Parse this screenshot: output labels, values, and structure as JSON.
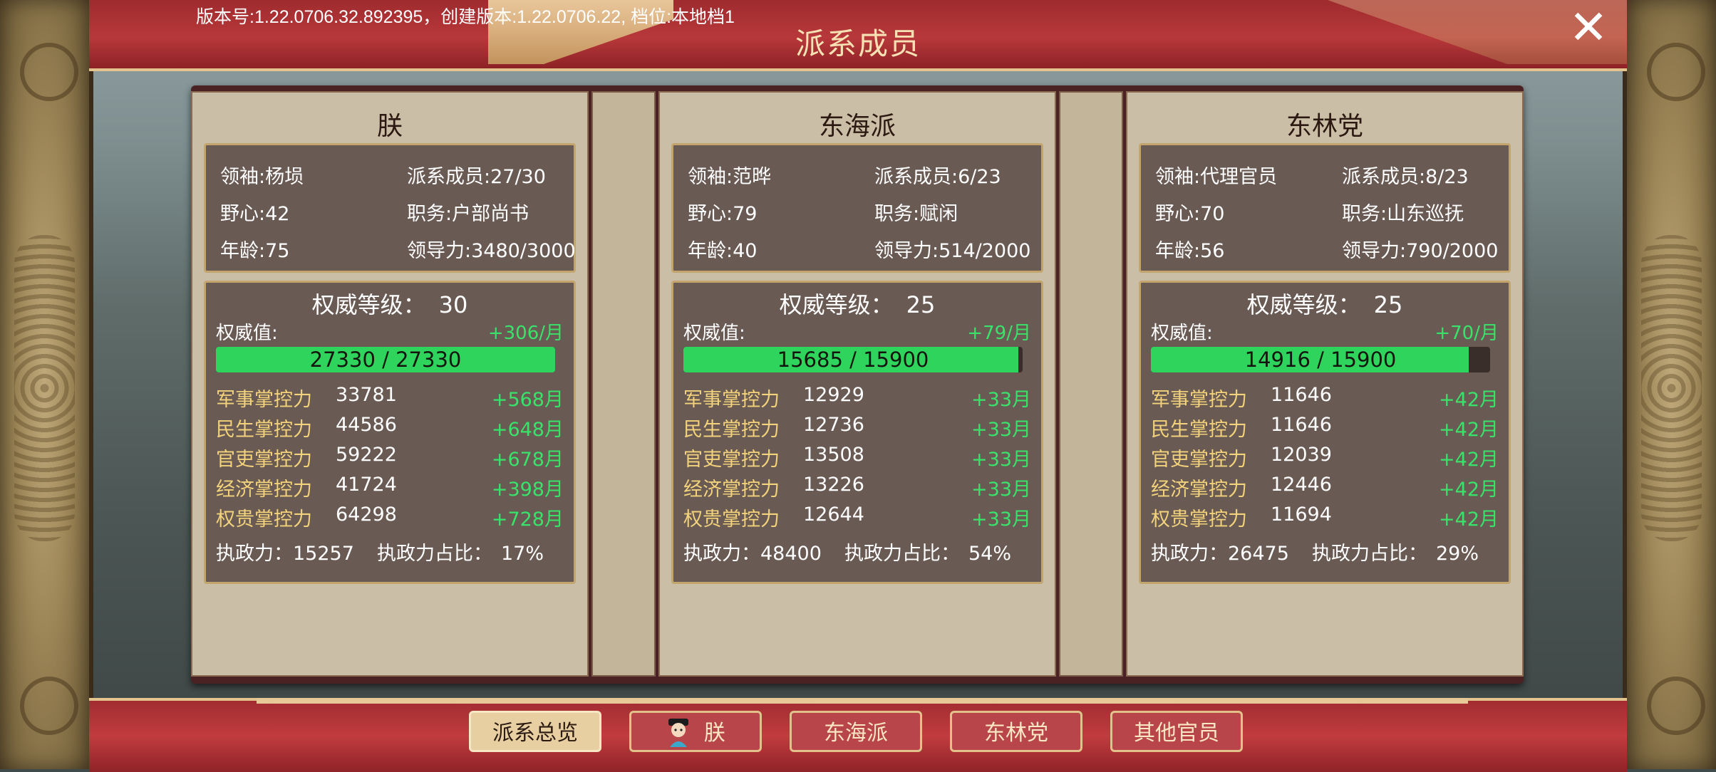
{
  "version_text": "版本号:1.22.0706.32.892395，创建版本:1.22.0706.22, 档位:本地档1",
  "title": "派系成员",
  "factions": [
    {
      "name": "朕",
      "info": {
        "leader": "领袖:杨埙",
        "members": "派系成员:27/30",
        "ambition": "野心:42",
        "post": "职务:户部尚书",
        "age": "年龄:75",
        "leadership": "领导力:3480/3000"
      },
      "authority_level_label": "权威等级：",
      "authority_level": "30",
      "authority_label": "权威值:",
      "authority_rate": "+306/月",
      "authority_text": "27330 / 27330",
      "authority_fraction": 1.0,
      "controls": [
        {
          "name": "军事掌控力",
          "value": "33781",
          "rate": "+568月"
        },
        {
          "name": "民生掌控力",
          "value": "44586",
          "rate": "+648月"
        },
        {
          "name": "官吏掌控力",
          "value": "59222",
          "rate": "+678月"
        },
        {
          "name": "经济掌控力",
          "value": "41724",
          "rate": "+398月"
        },
        {
          "name": "权贵掌控力",
          "value": "64298",
          "rate": "+728月"
        }
      ],
      "exec_label": "执政力：",
      "exec_value": "15257",
      "exec_ratio_label": "执政力占比：",
      "exec_ratio": "17%"
    },
    {
      "name": "东海派",
      "info": {
        "leader": "领袖:范晔",
        "members": "派系成员:6/23",
        "ambition": "野心:79",
        "post": "职务:赋闲",
        "age": "年龄:40",
        "leadership": "领导力:514/2000"
      },
      "authority_level_label": "权威等级：",
      "authority_level": "25",
      "authority_label": "权威值:",
      "authority_rate": "+79/月",
      "authority_text": "15685 / 15900",
      "authority_fraction": 0.9865,
      "controls": [
        {
          "name": "军事掌控力",
          "value": "12929",
          "rate": "+33月"
        },
        {
          "name": "民生掌控力",
          "value": "12736",
          "rate": "+33月"
        },
        {
          "name": "官吏掌控力",
          "value": "13508",
          "rate": "+33月"
        },
        {
          "name": "经济掌控力",
          "value": "13226",
          "rate": "+33月"
        },
        {
          "name": "权贵掌控力",
          "value": "12644",
          "rate": "+33月"
        }
      ],
      "exec_label": "执政力：",
      "exec_value": "48400",
      "exec_ratio_label": "执政力占比：",
      "exec_ratio": "54%"
    },
    {
      "name": "东林党",
      "info": {
        "leader": "领袖:代理官员",
        "members": "派系成员:8/23",
        "ambition": "野心:70",
        "post": "职务:山东巡抚",
        "age": "年龄:56",
        "leadership": "领导力:790/2000"
      },
      "authority_level_label": "权威等级：",
      "authority_level": "25",
      "authority_label": "权威值:",
      "authority_rate": "+70/月",
      "authority_text": "14916 / 15900",
      "authority_fraction": 0.938,
      "controls": [
        {
          "name": "军事掌控力",
          "value": "11646",
          "rate": "+42月"
        },
        {
          "name": "民生掌控力",
          "value": "11646",
          "rate": "+42月"
        },
        {
          "name": "官吏掌控力",
          "value": "12039",
          "rate": "+42月"
        },
        {
          "name": "经济掌控力",
          "value": "12446",
          "rate": "+42月"
        },
        {
          "name": "权贵掌控力",
          "value": "11694",
          "rate": "+42月"
        }
      ],
      "exec_label": "执政力：",
      "exec_value": "26475",
      "exec_ratio_label": "执政力占比：",
      "exec_ratio": "29%"
    }
  ],
  "tabs": [
    {
      "label": "派系总览",
      "active": true
    },
    {
      "label": "朕",
      "active": false,
      "icon": "emperor-avatar-icon"
    },
    {
      "label": "东海派",
      "active": false
    },
    {
      "label": "东林党",
      "active": false
    },
    {
      "label": "其他官员",
      "active": false
    }
  ],
  "colors": {
    "banner_red": "#b8383a",
    "gold": "#e3c48e",
    "bar_green": "#2ed45c",
    "rate_green": "#39e36a",
    "stat_name_yellow": "#f2d27a",
    "panel_brown": "#6a5a54"
  }
}
